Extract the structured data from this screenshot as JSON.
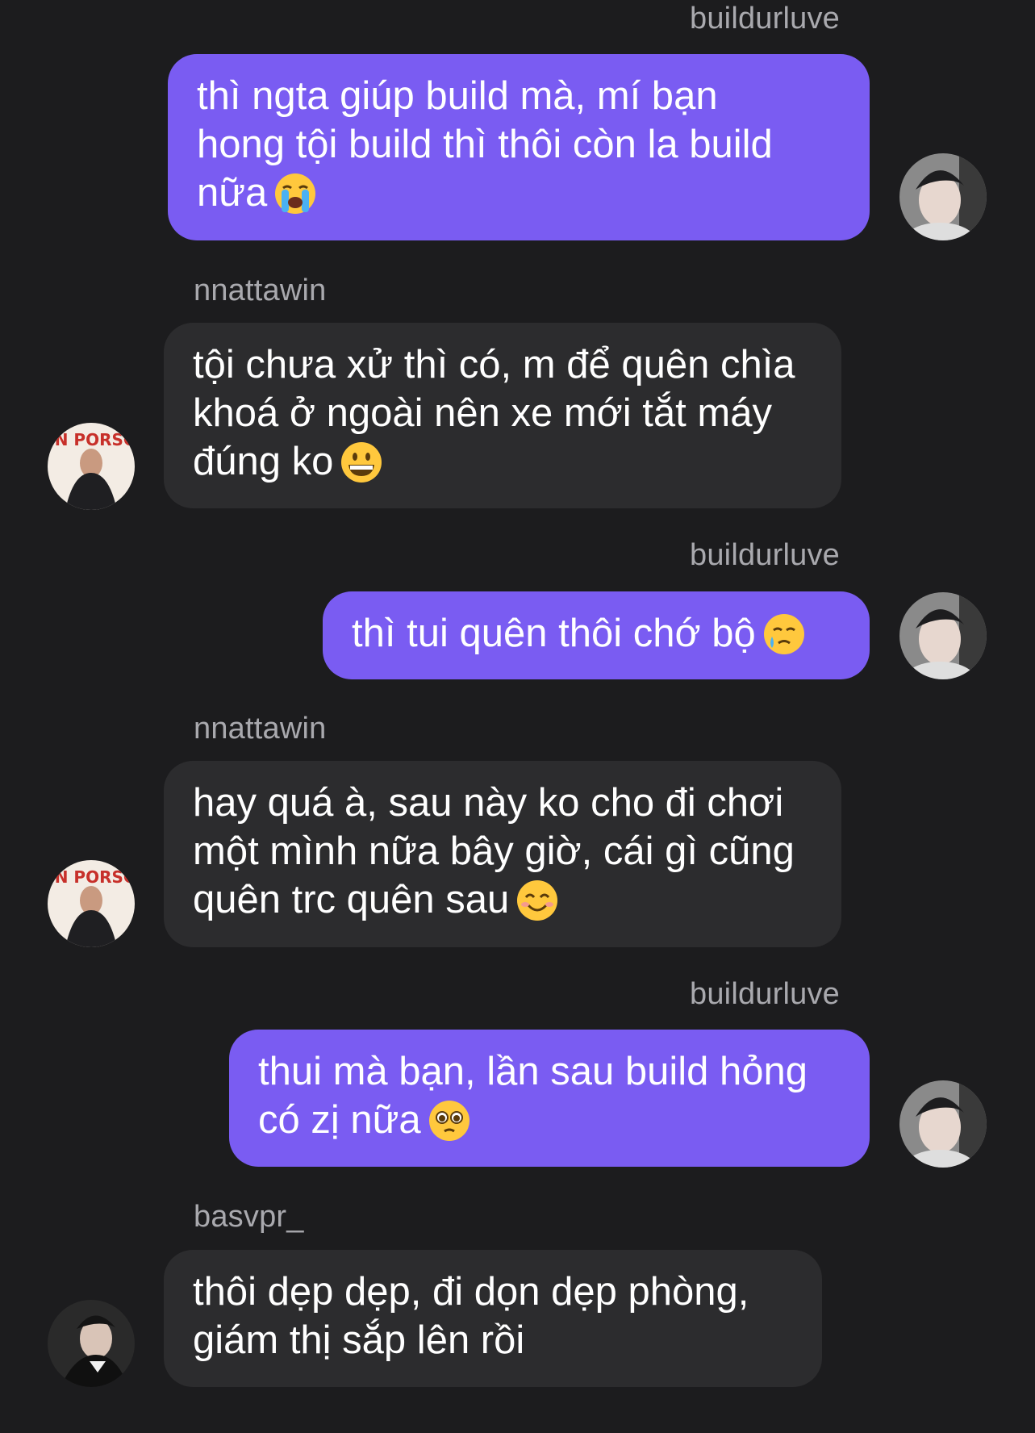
{
  "messages": [
    {
      "sender": "buildurluve",
      "direction": "out",
      "lines": [
        "thì ngta giúp build mà, mí bạn",
        "hong tội build thì thôi còn la build",
        "nữa"
      ],
      "emoji": "loudly-crying-face-emoji"
    },
    {
      "sender": "nnattawin",
      "direction": "in",
      "lines": [
        "tội chưa xử thì có, m để quên chìa",
        "khoá ở ngoài nên xe mới tắt máy",
        "đúng ko"
      ],
      "emoji": "grinning-face-emoji"
    },
    {
      "sender": "buildurluve",
      "direction": "out",
      "lines": [
        "thì tui quên thôi chớ bộ"
      ],
      "emoji": "face-holding-back-tears-emoji"
    },
    {
      "sender": "nnattawin",
      "direction": "in",
      "lines": [
        "hay quá à, sau này ko cho đi chơi",
        "một mình nữa bây giờ, cái gì cũng",
        "quên trc quên sau"
      ],
      "emoji": "smiling-face-with-smiling-eyes-emoji"
    },
    {
      "sender": "buildurluve",
      "direction": "out",
      "lines": [
        "thui mà bạn, lần sau build hỏng",
        "có zị nữa"
      ],
      "emoji": "pleading-face-emoji"
    },
    {
      "sender": "basvpr_",
      "direction": "in",
      "lines": [
        "thôi dẹp dẹp, đi dọn dẹp phòng,",
        "giám thị sắp lên rồi"
      ]
    }
  ],
  "avatars": {
    "buildurluve": "avatar-buildurluve",
    "nnattawin": "avatar-nnattawin",
    "nnattawin_overlay_text": "KINN PORSCHE",
    "basvpr_": "avatar-basvpr"
  },
  "colors": {
    "background": "#1c1c1e",
    "outgoing_bubble": "#7a5cf2",
    "incoming_bubble": "#2c2c2e",
    "sender_text": "#a9a9ae",
    "message_text": "#ffffff"
  }
}
